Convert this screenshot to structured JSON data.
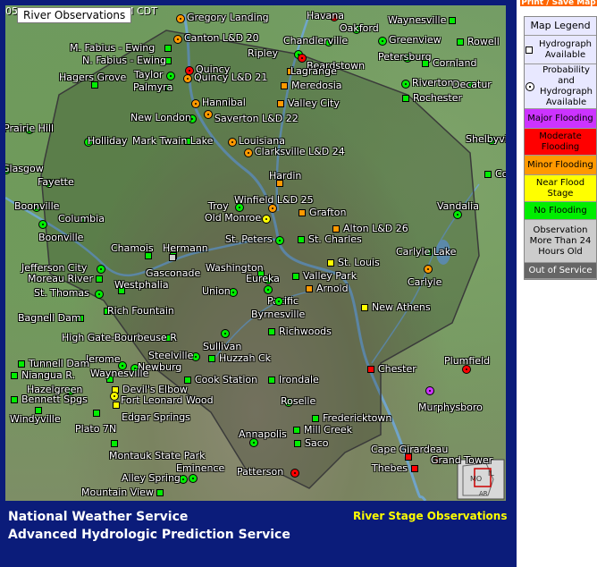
{
  "header": {
    "tooltip": "River Observations",
    "time_fragment_left": "05",
    "time_fragment_right": "M CDT",
    "print_button": "Print / Save Map"
  },
  "footer": {
    "agency_line1": "National Weather Service",
    "agency_line2": "Advanced Hydrologic Prediction Service",
    "product": "River Stage Observations"
  },
  "legend": {
    "title": "Map Legend",
    "items": [
      {
        "label": "Hydrograph Available",
        "symbol": "square",
        "color": "#e8e8ff"
      },
      {
        "label": "Probability and Hydrograph Available",
        "symbol": "circle",
        "color": "#e8e8ff"
      },
      {
        "label": "Major Flooding",
        "color": "#cc33ff"
      },
      {
        "label": "Moderate Flooding",
        "color": "#ff0000"
      },
      {
        "label": "Minor Flooding",
        "color": "#ff9900"
      },
      {
        "label": "Near Flood Stage",
        "color": "#ffff00"
      },
      {
        "label": "No Flooding",
        "color": "#00ee00"
      },
      {
        "label": "Observation More Than 24 Hours Old",
        "color": "#cccccc"
      },
      {
        "label": "Out of Service",
        "color": "#666666"
      }
    ]
  },
  "colors": {
    "major": "#cc33ff",
    "moderate": "#ff0000",
    "minor": "#ff9900",
    "near": "#ffff00",
    "none": "#00ee00",
    "old": "#cccccc",
    "out": "#666666",
    "river": "#6fa8dc",
    "boundary": "#4a4a4a"
  },
  "stations": [
    {
      "name": "Gregory Landing",
      "status": "minor",
      "symbol": "circle"
    },
    {
      "name": "Canton L&D 20",
      "status": "minor",
      "symbol": "circle"
    },
    {
      "name": "M. Fabius - Ewing",
      "status": "none",
      "symbol": "square"
    },
    {
      "name": "N. Fabius - Ewing",
      "status": "none",
      "symbol": "square"
    },
    {
      "name": "Quincy",
      "status": "moderate",
      "symbol": "circle"
    },
    {
      "name": "Hagers Grove",
      "status": "none",
      "symbol": "square"
    },
    {
      "name": "Taylor",
      "status": "none",
      "symbol": "circle"
    },
    {
      "name": "Quincy L&D 21",
      "status": "minor",
      "symbol": "circle"
    },
    {
      "name": "Palmyra",
      "status": "none",
      "symbol": "square"
    },
    {
      "name": "Hannibal",
      "status": "minor",
      "symbol": "circle"
    },
    {
      "name": "New London",
      "status": "none",
      "symbol": "circle"
    },
    {
      "name": "Saverton L&D 22",
      "status": "minor",
      "symbol": "circle"
    },
    {
      "name": "Holliday",
      "status": "none",
      "symbol": "circle"
    },
    {
      "name": "Mark Twain Lake",
      "status": "none",
      "symbol": "square"
    },
    {
      "name": "Louisiana",
      "status": "minor",
      "symbol": "circle"
    },
    {
      "name": "Clarksville L&D 24",
      "status": "minor",
      "symbol": "circle"
    },
    {
      "name": "Havana",
      "status": "moderate",
      "symbol": "circle"
    },
    {
      "name": "Waynesville",
      "status": "none",
      "symbol": "square"
    },
    {
      "name": "Oakford",
      "status": "none",
      "symbol": "circle"
    },
    {
      "name": "Chandlerville",
      "status": "none",
      "symbol": "circle"
    },
    {
      "name": "Greenview",
      "status": "none",
      "symbol": "circle"
    },
    {
      "name": "Rowell",
      "status": "none",
      "symbol": "square"
    },
    {
      "name": "Ripley",
      "status": "none",
      "symbol": "circle"
    },
    {
      "name": "Beardstown",
      "status": "moderate",
      "symbol": "circle"
    },
    {
      "name": "Petersburg",
      "status": "none",
      "symbol": "circle"
    },
    {
      "name": "Cornland",
      "status": "none",
      "symbol": "square"
    },
    {
      "name": "Lagrange",
      "status": "minor",
      "symbol": "square"
    },
    {
      "name": "Meredosia",
      "status": "minor",
      "symbol": "square"
    },
    {
      "name": "Decatur",
      "status": "none",
      "symbol": "square"
    },
    {
      "name": "Riverton",
      "status": "none",
      "symbol": "circle"
    },
    {
      "name": "Valley City",
      "status": "minor",
      "symbol": "square"
    },
    {
      "name": "Rochester",
      "status": "none",
      "symbol": "square"
    },
    {
      "name": "Shelbyville",
      "status": "none",
      "symbol": "circle"
    },
    {
      "name": "Cowden",
      "status": "none",
      "symbol": "square"
    },
    {
      "name": "Prairie Hill",
      "status": "none",
      "symbol": "circle"
    },
    {
      "name": "Glasgow",
      "status": "none",
      "symbol": "circle"
    },
    {
      "name": "Fayette",
      "status": "none",
      "symbol": "circle"
    },
    {
      "name": "Boonville",
      "status": "none",
      "symbol": "circle"
    },
    {
      "name": "Columbia",
      "status": "none",
      "symbol": "square"
    },
    {
      "name": "Boonville",
      "status": "none",
      "symbol": "circle"
    },
    {
      "name": "Hardin",
      "status": "minor",
      "symbol": "square"
    },
    {
      "name": "Winfield L&D 25",
      "status": "minor",
      "symbol": "circle"
    },
    {
      "name": "Troy",
      "status": "none",
      "symbol": "circle"
    },
    {
      "name": "Grafton",
      "status": "minor",
      "symbol": "square"
    },
    {
      "name": "Old Monroe",
      "status": "near",
      "symbol": "circle"
    },
    {
      "name": "Alton L&D 26",
      "status": "minor",
      "symbol": "square"
    },
    {
      "name": "Vandalia",
      "status": "none",
      "symbol": "circle"
    },
    {
      "name": "St. Peters",
      "status": "none",
      "symbol": "circle"
    },
    {
      "name": "St. Charles",
      "status": "none",
      "symbol": "square"
    },
    {
      "name": "Chamois",
      "status": "none",
      "symbol": "square"
    },
    {
      "name": "Hermann",
      "status": "none",
      "symbol": "square"
    },
    {
      "name": "Gasconade",
      "status": "old",
      "symbol": "square"
    },
    {
      "name": "Carlyle Lake",
      "status": "none",
      "symbol": "square"
    },
    {
      "name": "Carlyle",
      "status": "minor",
      "symbol": "circle"
    },
    {
      "name": "Jefferson City",
      "status": "none",
      "symbol": "circle"
    },
    {
      "name": "Moreau River",
      "status": "none",
      "symbol": "square"
    },
    {
      "name": "Washington",
      "status": "none",
      "symbol": "square"
    },
    {
      "name": "St. Louis",
      "status": "near",
      "symbol": "square"
    },
    {
      "name": "Eureka",
      "status": "none",
      "symbol": "circle"
    },
    {
      "name": "Valley Park",
      "status": "none",
      "symbol": "square"
    },
    {
      "name": "Westphalia",
      "status": "none",
      "symbol": "square"
    },
    {
      "name": "St. Thomas",
      "status": "none",
      "symbol": "circle"
    },
    {
      "name": "Union",
      "status": "none",
      "symbol": "circle"
    },
    {
      "name": "Pacific",
      "status": "none",
      "symbol": "circle"
    },
    {
      "name": "Arnold",
      "status": "minor",
      "symbol": "square"
    },
    {
      "name": "Rich Fountain",
      "status": "none",
      "symbol": "square"
    },
    {
      "name": "Byrnesville",
      "status": "none",
      "symbol": "circle"
    },
    {
      "name": "New Athens",
      "status": "near",
      "symbol": "square"
    },
    {
      "name": "Bagnell Dam",
      "status": "none",
      "symbol": "square"
    },
    {
      "name": "Richwoods",
      "status": "none",
      "symbol": "square"
    },
    {
      "name": "Sullivan",
      "status": "none",
      "symbol": "circle"
    },
    {
      "name": "High Gate-Bourbeuse R",
      "status": "none",
      "symbol": "square"
    },
    {
      "name": "Jerome",
      "status": "none",
      "symbol": "circle"
    },
    {
      "name": "Steelville",
      "status": "none",
      "symbol": "circle"
    },
    {
      "name": "Huzzah Ck",
      "status": "none",
      "symbol": "square"
    },
    {
      "name": "Tunnell Dam",
      "status": "none",
      "symbol": "square"
    },
    {
      "name": "Newburg",
      "status": "none",
      "symbol": "circle"
    },
    {
      "name": "Chester",
      "status": "moderate",
      "symbol": "square"
    },
    {
      "name": "Plumfield",
      "status": "moderate",
      "symbol": "circle"
    },
    {
      "name": "Niangua R.",
      "status": "none",
      "symbol": "square"
    },
    {
      "name": "Waynesville",
      "status": "none",
      "symbol": "square"
    },
    {
      "name": "Hazelgreen",
      "status": "none",
      "symbol": "circle"
    },
    {
      "name": "Cook Station",
      "status": "none",
      "symbol": "square"
    },
    {
      "name": "Irondale",
      "status": "none",
      "symbol": "square"
    },
    {
      "name": "Devil's Elbow",
      "status": "near",
      "symbol": "square"
    },
    {
      "name": "Fort Leonard Wood",
      "status": "near",
      "symbol": "circle"
    },
    {
      "name": "Murphysboro",
      "status": "major",
      "symbol": "circle"
    },
    {
      "name": "Bennett Spgs",
      "status": "none",
      "symbol": "square"
    },
    {
      "name": "Windyville",
      "status": "none",
      "symbol": "square"
    },
    {
      "name": "Edgar Springs",
      "status": "near",
      "symbol": "square"
    },
    {
      "name": "Roselle",
      "status": "none",
      "symbol": "circle"
    },
    {
      "name": "Fredericktown",
      "status": "none",
      "symbol": "square"
    },
    {
      "name": "Plato 7N",
      "status": "none",
      "symbol": "square"
    },
    {
      "name": "Mill Creek",
      "status": "none",
      "symbol": "square"
    },
    {
      "name": "Montauk State Park",
      "status": "none",
      "symbol": "square"
    },
    {
      "name": "Annapolis",
      "status": "none",
      "symbol": "circle"
    },
    {
      "name": "Saco",
      "status": "none",
      "symbol": "square"
    },
    {
      "name": "Cape Girardeau",
      "status": "moderate",
      "symbol": "square"
    },
    {
      "name": "Thebes",
      "status": "moderate",
      "symbol": "square"
    },
    {
      "name": "Grand Tower",
      "status": "moderate",
      "symbol": "square"
    },
    {
      "name": "Eminence",
      "status": "none",
      "symbol": "circle"
    },
    {
      "name": "Alley Spring",
      "status": "none",
      "symbol": "circle"
    },
    {
      "name": "Patterson",
      "status": "moderate",
      "symbol": "circle"
    },
    {
      "name": "Mountain View",
      "status": "none",
      "symbol": "square"
    }
  ],
  "inset": {
    "labels": [
      "MO",
      "IL",
      "AR"
    ]
  }
}
